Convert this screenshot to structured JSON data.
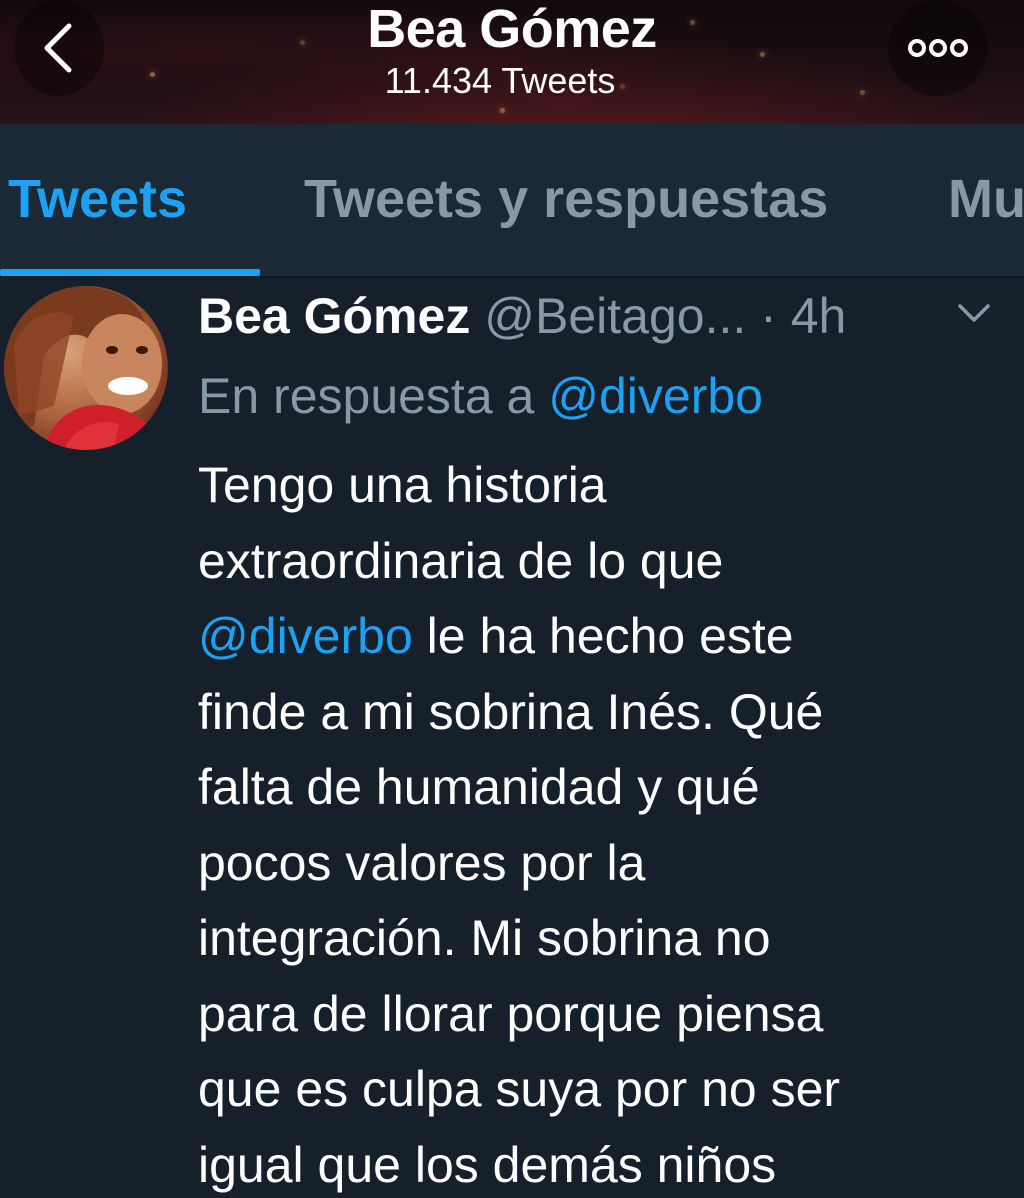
{
  "header": {
    "title": "Bea Gómez",
    "subtitle": "11.434 Tweets",
    "back_icon": "chevron-left-icon",
    "more_icon": "more-horizontal-icon"
  },
  "tabs": [
    {
      "label": "Tweets",
      "active": true
    },
    {
      "label": "Tweets y respuestas",
      "active": false
    },
    {
      "label": "Mu",
      "active": false
    }
  ],
  "tweet": {
    "author_name": "Bea Gómez",
    "author_handle": "@Beitago...",
    "time": "· 4h",
    "reply_prefix": "En respuesta a",
    "reply_to": "@diverbo",
    "body_lines": [
      "Tengo una historia",
      "extraordinaria de lo que",
      "le ha hecho este",
      "finde a mi sobrina Inés. Qué",
      "falta de humanidad y qué",
      "pocos valores por la",
      "integración. Mi sobrina no",
      "para de llorar porque piensa",
      "que es culpa suya por no ser",
      "igual que los demás niños"
    ],
    "body_mention": "@diverbo"
  },
  "colors": {
    "background": "#15202b",
    "tab_bar": "#1b2836",
    "accent": "#1da1f2",
    "muted": "#8899a6",
    "text": "#ffffff"
  }
}
